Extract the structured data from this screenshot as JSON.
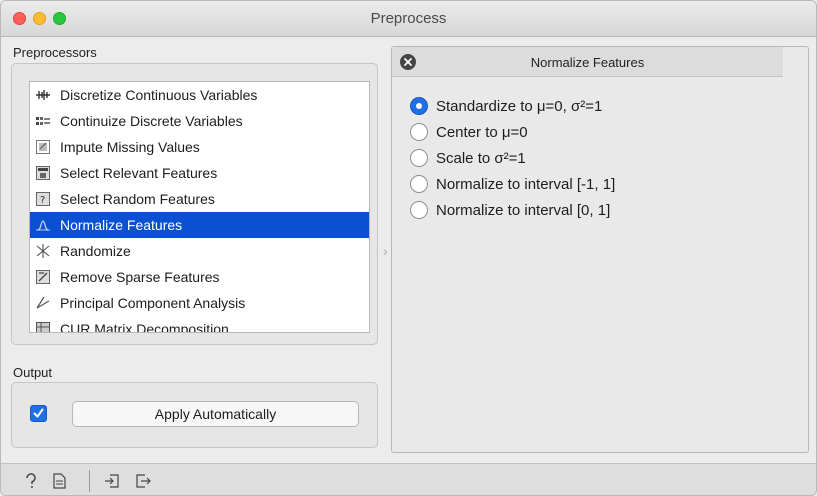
{
  "window": {
    "title": "Preprocess"
  },
  "preprocessors": {
    "label": "Preprocessors",
    "items": [
      {
        "label": "Discretize Continuous Variables",
        "icon": "discretize-icon",
        "selected": false
      },
      {
        "label": "Continuize Discrete Variables",
        "icon": "continuize-icon",
        "selected": false
      },
      {
        "label": "Impute Missing Values",
        "icon": "impute-icon",
        "selected": false
      },
      {
        "label": "Select Relevant Features",
        "icon": "select-relevant-icon",
        "selected": false
      },
      {
        "label": "Select Random Features",
        "icon": "select-random-icon",
        "selected": false
      },
      {
        "label": "Normalize Features",
        "icon": "normalize-icon",
        "selected": true
      },
      {
        "label": "Randomize",
        "icon": "randomize-icon",
        "selected": false
      },
      {
        "label": "Remove Sparse Features",
        "icon": "remove-sparse-icon",
        "selected": false
      },
      {
        "label": "Principal Component Analysis",
        "icon": "pca-icon",
        "selected": false
      },
      {
        "label": "CUR Matrix Decomposition",
        "icon": "cur-icon",
        "selected": false
      }
    ]
  },
  "output": {
    "label": "Output",
    "apply_automatically_checked": true,
    "apply_label": "Apply Automatically"
  },
  "editor": {
    "title": "Normalize Features",
    "options": [
      {
        "label": "Standardize to μ=0, σ²=1",
        "checked": true
      },
      {
        "label": "Center to μ=0",
        "checked": false
      },
      {
        "label": "Scale to σ²=1",
        "checked": false
      },
      {
        "label": "Normalize to interval [-1, 1]",
        "checked": false
      },
      {
        "label": "Normalize to interval [0, 1]",
        "checked": false
      }
    ]
  },
  "statusbar": {
    "icons": [
      "help-icon",
      "report-icon",
      "input-icon",
      "output-icon"
    ]
  },
  "colors": {
    "selection": "#0a50d0",
    "accent": "#1f6fe6"
  }
}
